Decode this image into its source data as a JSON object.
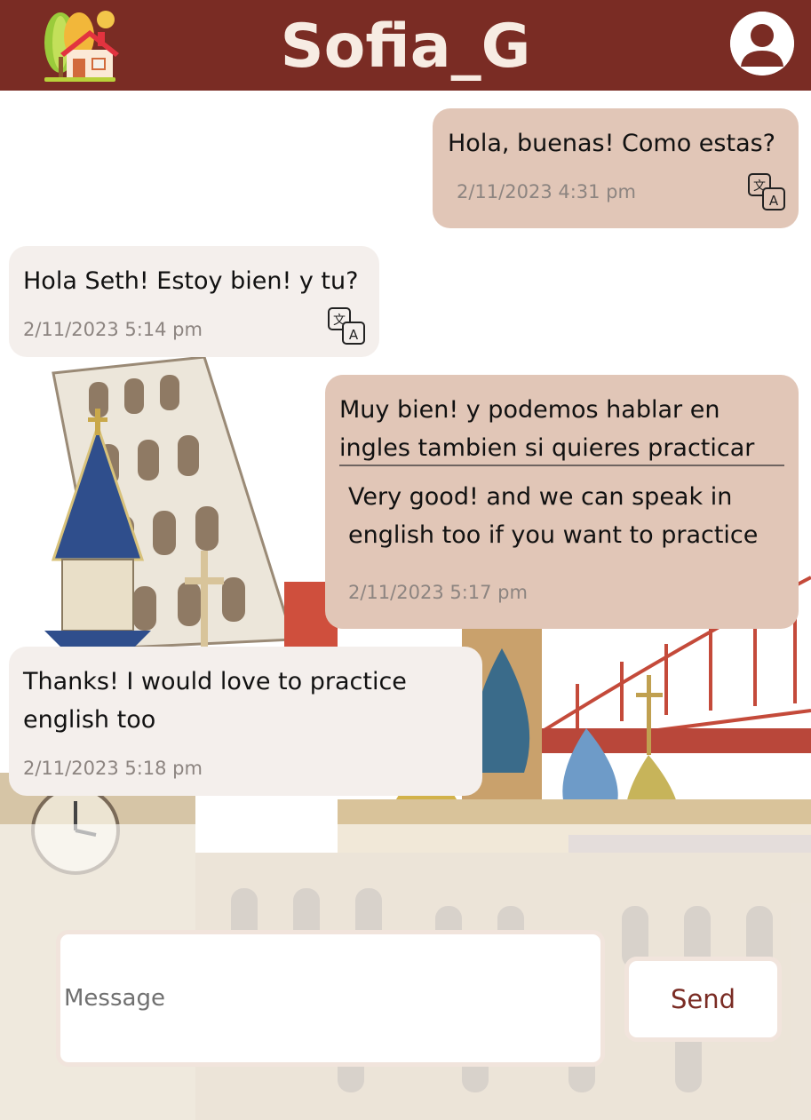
{
  "header": {
    "title": "Sofia_G",
    "home_icon": "house-trees-icon",
    "profile_icon": "user-avatar-icon",
    "bar_color": "#7a2c24"
  },
  "messages": [
    {
      "direction": "outgoing",
      "text": "Hola, buenas! Como estas?",
      "timestamp": "2/11/2023 4:31 pm",
      "translate_icon": "translate-icon"
    },
    {
      "direction": "incoming",
      "text": "Hola Seth! Estoy bien! y tu?",
      "timestamp": "2/11/2023 5:14 pm",
      "translate_icon": "translate-icon"
    },
    {
      "direction": "outgoing",
      "text_line1": "Muy bien! y podemos hablar en",
      "text_line2": "ingles tambien si quieres practicar",
      "translation_line1": "Very good! and we can speak in",
      "translation_line2": "english too if you want to practice",
      "timestamp": "2/11/2023 5:17 pm"
    },
    {
      "direction": "incoming",
      "text_line1": "Thanks! I would love to practice",
      "text_line2": "english too",
      "timestamp": "2/11/2023 5:18 pm"
    }
  ],
  "composer": {
    "placeholder": "Message",
    "value": "",
    "send_label": "Send"
  },
  "colors": {
    "outgoing_bubble": "#e1c6b7",
    "incoming_bubble": "#f4efec",
    "accent": "#7a2c24"
  }
}
